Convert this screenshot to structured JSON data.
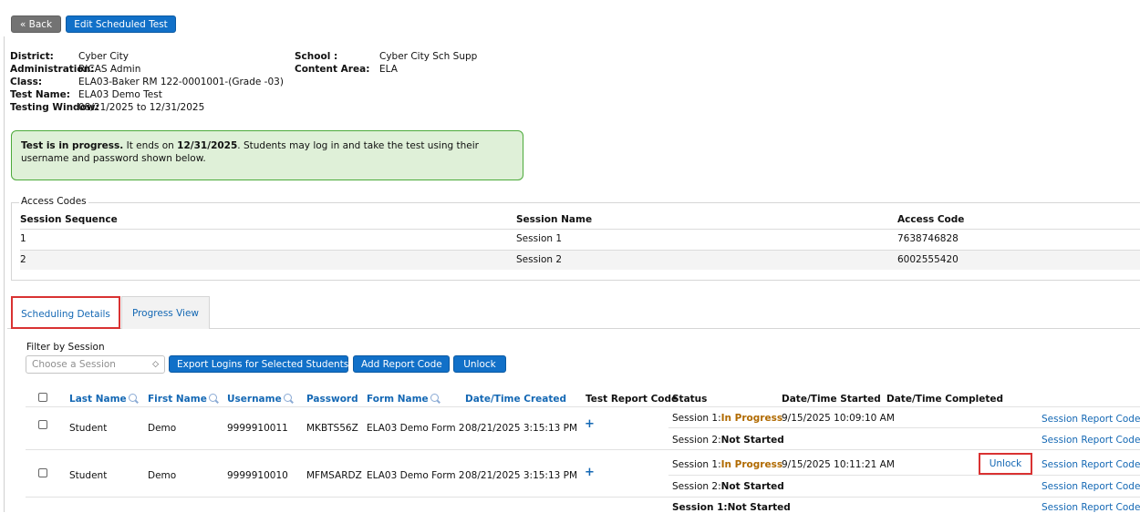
{
  "toolbar": {
    "back_label": "« Back",
    "edit_label": "Edit Scheduled Test"
  },
  "info": {
    "district_label": "District:",
    "district_value": "Cyber City",
    "admin_label": "Administration:",
    "admin_value": "RICAS Admin",
    "class_label": "Class:",
    "class_value": "ELA03-Baker RM 122-0001001-(Grade -03)",
    "testname_label": "Test Name:",
    "testname_value": "ELA03 Demo Test",
    "window_label": "Testing Window:",
    "window_value": "08/21/2025 to 12/31/2025",
    "school_label": "School :",
    "school_value": "Cyber City Sch Supp",
    "content_label": "Content Area:",
    "content_value": "ELA"
  },
  "banner": {
    "lead": "Test is in progress.",
    "mid": " It ends on ",
    "date": "12/31/2025",
    "tail": ". Students may log in and take the test using their username and password shown below."
  },
  "access": {
    "title": "Access Codes",
    "headers": [
      "Session Sequence",
      "Session Name",
      "Access Code"
    ],
    "rows": [
      {
        "seq": "1",
        "name": "Session 1",
        "code": "7638746828"
      },
      {
        "seq": "2",
        "name": "Session 2",
        "code": "6002555420"
      }
    ]
  },
  "tabs": {
    "scheduling": "Scheduling Details",
    "progress": "Progress View"
  },
  "filter": {
    "label": "Filter by Session",
    "placeholder": "Choose a Session"
  },
  "actions": {
    "export": "Export Logins for Selected Students",
    "add_report": "Add Report Code",
    "unlock": "Unlock"
  },
  "grid": {
    "headers": {
      "last": "Last Name",
      "first": "First Name",
      "username": "Username",
      "password": "Password",
      "form": "Form Name",
      "created": "Date/Time Created",
      "report": "Test Report Code",
      "status": "Status",
      "started": "Date/Time Started",
      "completed": "Date/Time Completed"
    },
    "rows": [
      {
        "last": "Student",
        "first": "Demo",
        "username": "9999910011",
        "password": "MKBTS56Z",
        "form": "ELA03 Demo Form 2",
        "created": "08/21/2025 3:15:13 PM",
        "s1_prefix": "Session 1:",
        "s1_status": "In Progress",
        "s1_started": "9/15/2025 10:09:10 AM",
        "s2_prefix": "Session 2:",
        "s2_status": "Not Started"
      },
      {
        "last": "Student",
        "first": "Demo",
        "username": "9999910010",
        "password": "MFMSARDZ",
        "form": "ELA03 Demo Form 2",
        "created": "08/21/2025 3:15:13 PM",
        "s1_prefix": "Session 1:",
        "s1_status": "In Progress",
        "s1_started": "9/15/2025 10:11:21 AM",
        "s2_prefix": "Session 2:",
        "s2_status": "Not Started"
      }
    ],
    "partial_status": "Session 1:Not Started",
    "row_unlock": "Unlock",
    "session_report_link": "Session Report Codes",
    "plus_icon": "+"
  },
  "colors": {
    "primary_button": "#1170c8",
    "back_button": "#737373",
    "banner_bg": "#dff0d8",
    "banner_border": "#4caa3a",
    "highlight": "#d93232",
    "in_progress": "#b06a00"
  }
}
